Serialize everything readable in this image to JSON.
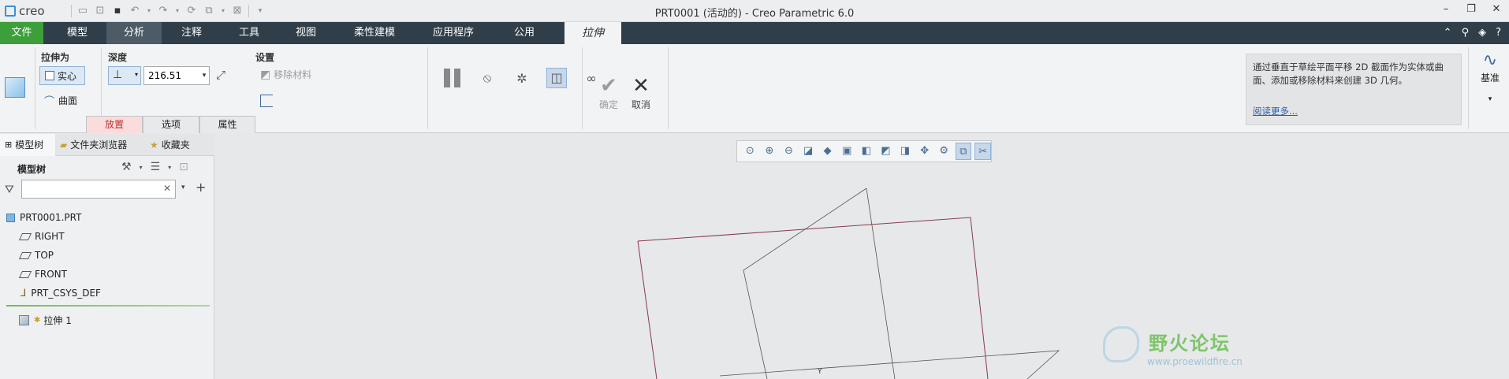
{
  "titlebar": {
    "logo": "creo",
    "title": "PRT0001 (活动的) - Creo Parametric 6.0",
    "controls": [
      "–",
      "❐",
      "✕"
    ]
  },
  "menu": {
    "file": "文件",
    "items": [
      "模型",
      "分析",
      "注释",
      "工具",
      "视图",
      "柔性建模",
      "应用程序",
      "公用"
    ],
    "context_tab": "拉伸"
  },
  "ribbon": {
    "extrude_as_label": "拉伸为",
    "solid_label": "实心",
    "surface_label": "曲面",
    "depth_label": "深度",
    "depth_value": "216.51",
    "settings_label": "设置",
    "remove_material_label": "移除材料",
    "tabs": [
      "放置",
      "选项",
      "属性"
    ],
    "ok_label": "确定",
    "cancel_label": "取消",
    "help_text": "通过垂直于草绘平面平移 2D 截面作为实体或曲面、添加或移除材料来创建 3D 几何。",
    "help_link": "阅读更多...",
    "datum_label": "基准"
  },
  "panel": {
    "tabs": [
      "模型树",
      "文件夹浏览器",
      "收藏夹"
    ],
    "tree_header": "模型树",
    "search_value": "",
    "tree": {
      "root": "PRT0001.PRT",
      "children": [
        "RIGHT",
        "TOP",
        "FRONT",
        "PRT_CSYS_DEF"
      ],
      "feature": "拉伸 1"
    }
  },
  "watermark": {
    "title": "野火论坛",
    "url": "www.proewildfire.cn"
  },
  "colors": {
    "menubar": "#2f3e48",
    "file_tab": "#3d9f3a",
    "placement_tab": "#fbdcdc",
    "sketch_lines": "#8a3a4a"
  }
}
